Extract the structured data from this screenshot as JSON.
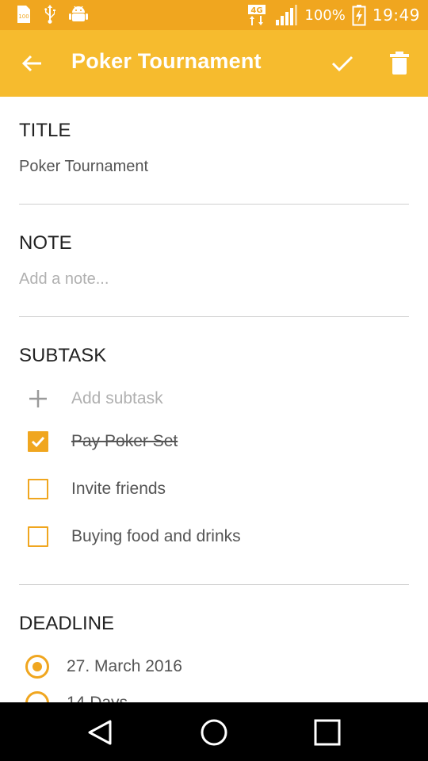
{
  "status_bar": {
    "signal_type": "4G",
    "battery": "100%",
    "time": "19:49",
    "left_icons": [
      "sim-100-icon",
      "usb-icon",
      "android-debug-icon"
    ]
  },
  "app_bar": {
    "title": "Poker Tournament",
    "back_icon": "arrow-back-icon",
    "save_icon": "check-icon",
    "delete_icon": "trash-icon"
  },
  "title_section": {
    "label": "TITLE",
    "value": "Poker Tournament"
  },
  "note_section": {
    "label": "NOTE",
    "placeholder": "Add a note..."
  },
  "subtask_section": {
    "label": "SUBTASK",
    "add_placeholder": "Add subtask",
    "items": [
      {
        "text": "Pay Poker Set",
        "done": true
      },
      {
        "text": "Invite friends",
        "done": false
      },
      {
        "text": "Buying food and drinks",
        "done": false
      }
    ]
  },
  "deadline_section": {
    "label": "DEADLINE",
    "options": [
      {
        "text": "27. March 2016",
        "selected": true
      },
      {
        "text": "14 Days",
        "selected": false
      }
    ]
  },
  "colors": {
    "accent": "#f0a61f",
    "app_bar": "#f6bb2e",
    "status_bar": "#f0a61f"
  }
}
